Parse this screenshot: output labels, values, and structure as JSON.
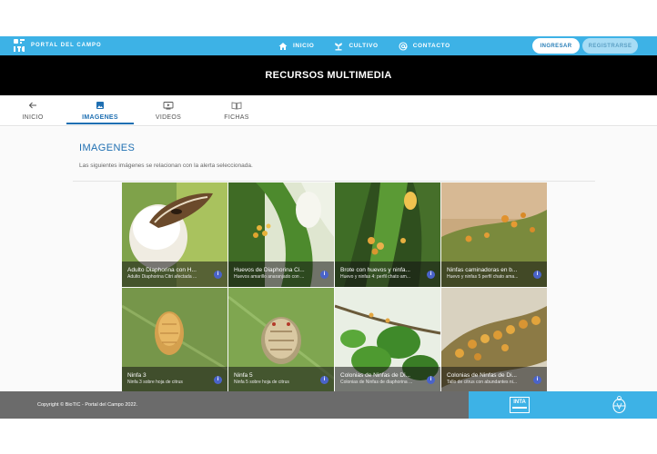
{
  "nav": {
    "brand": "PORTAL DEL CAMPO",
    "links": [
      {
        "label": "INICIO",
        "icon": "home-icon"
      },
      {
        "label": "CULTIVO",
        "icon": "plant-icon"
      },
      {
        "label": "CONTACTO",
        "icon": "at-sign-icon"
      }
    ],
    "login_label": "INGRESAR",
    "register_label": "REGISTRARSE"
  },
  "header": {
    "title": "RECURSOS MULTIMEDIA"
  },
  "tabs": [
    {
      "label": "INICIO",
      "icon": "arrow-left-icon",
      "active": false
    },
    {
      "label": "IMAGENES",
      "icon": "image-icon",
      "active": true
    },
    {
      "label": "VIDEOS",
      "icon": "video-icon",
      "active": false
    },
    {
      "label": "FICHAS",
      "icon": "book-icon",
      "active": false
    }
  ],
  "section": {
    "title": "IMAGENES",
    "subtitle": "Las siguientes imágenes se relacionan con la alerta seleccionada."
  },
  "images": [
    {
      "title": "Adulto Diaphorina con H...",
      "subtitle": "Adulto Diaphorina Citri afectada ..."
    },
    {
      "title": "Huevos de Diaphorina Ci...",
      "subtitle": "Huevos amarillo anaranjado con ..."
    },
    {
      "title": "Brote con huevos y ninfa...",
      "subtitle": "Huevo y ninfas 4: perfil chato am..."
    },
    {
      "title": "Ninfas caminadoras en b...",
      "subtitle": "Huevo y ninfas 5 perfil chato ama..."
    },
    {
      "title": "Ninfa 3",
      "subtitle": "Ninfa 3 sobre hoja de citrus"
    },
    {
      "title": "Ninfa 5",
      "subtitle": "Ninfa 5 sobre hoja de citrus"
    },
    {
      "title": "Colonias de Ninfas de Di...",
      "subtitle": "Colonias de Ninfas de diaphorina ..."
    },
    {
      "title": "Colonias de Ninfas de Di...",
      "subtitle": "Tallo de citrus con abundantes ni..."
    }
  ],
  "footer": {
    "copyright": "Copyright © BioTIC - Portal del Campo 2022.",
    "inta_logo": "INTA"
  },
  "colors": {
    "nav_blue": "#3db2e6",
    "accent_blue": "#1f6fb2",
    "title_band": "#000000",
    "footer_gray": "#6b6b6b",
    "info_badge": "#4a63c9"
  }
}
